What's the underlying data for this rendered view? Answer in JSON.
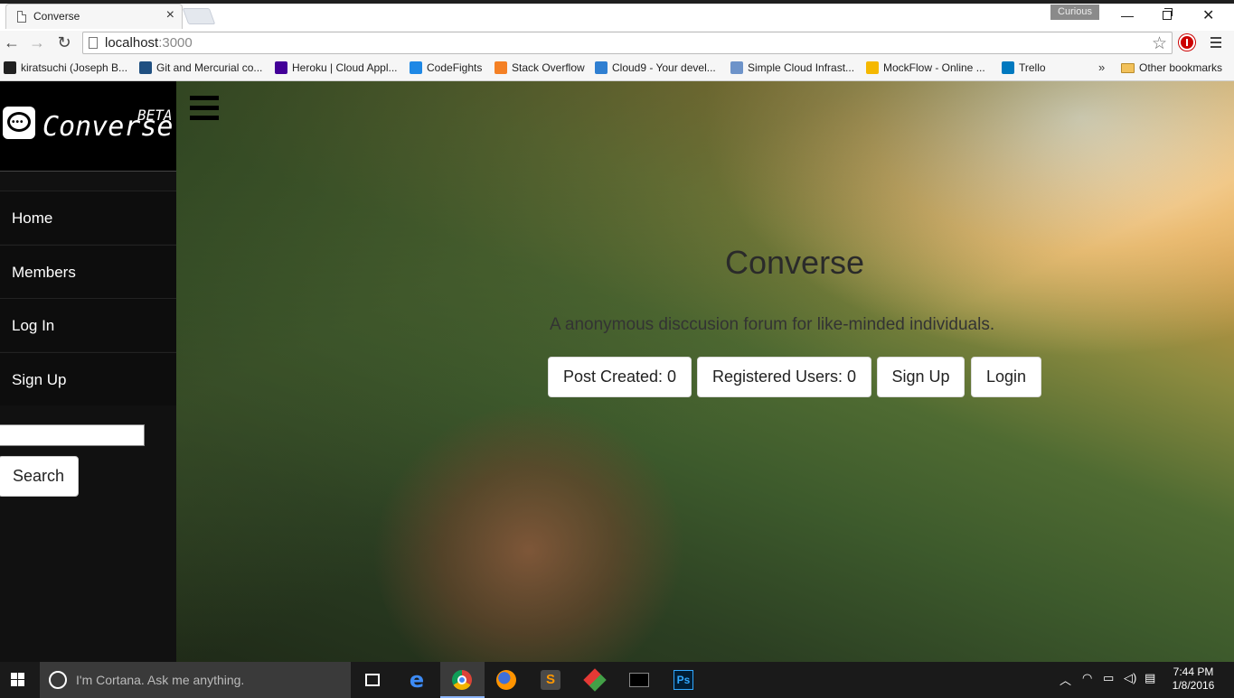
{
  "browser": {
    "tab_title": "Converse",
    "tab_close": "×",
    "profile_name": "Curious",
    "url_host": "localhost",
    "url_port": ":3000",
    "bookmarks": [
      {
        "label": "kiratsuchi (Joseph B...",
        "color": "#222222"
      },
      {
        "label": "Git and Mercurial co...",
        "color": "#205081"
      },
      {
        "label": "Heroku | Cloud Appl...",
        "color": "#430098"
      },
      {
        "label": "CodeFights",
        "color": "#1e88e5"
      },
      {
        "label": "Stack Overflow",
        "color": "#f48024"
      },
      {
        "label": "Cloud9 - Your devel...",
        "color": "#2f7fd1"
      },
      {
        "label": "Simple Cloud Infrast...",
        "color": "#6d93c9"
      },
      {
        "label": "MockFlow - Online ...",
        "color": "#f5b800"
      },
      {
        "label": "Trello",
        "color": "#0079bf"
      }
    ],
    "bookmarks_more": "»",
    "other_bookmarks": "Other bookmarks"
  },
  "sidebar": {
    "logo_text": "Converse",
    "logo_badge": "BETA",
    "items": [
      {
        "label": "Home"
      },
      {
        "label": "Members"
      },
      {
        "label": "Log In"
      },
      {
        "label": "Sign Up"
      }
    ],
    "search_value": "",
    "search_button": "Search"
  },
  "hero": {
    "title": "Converse",
    "subtitle": "A anonymous disccusion forum for like-minded individuals.",
    "buttons": [
      {
        "label": "Post Created: 0"
      },
      {
        "label": "Registered Users: 0"
      },
      {
        "label": "Sign Up"
      },
      {
        "label": "Login"
      }
    ]
  },
  "taskbar": {
    "cortana_placeholder": "I'm Cortana. Ask me anything.",
    "time": "7:44 PM",
    "date": "1/8/2016"
  }
}
